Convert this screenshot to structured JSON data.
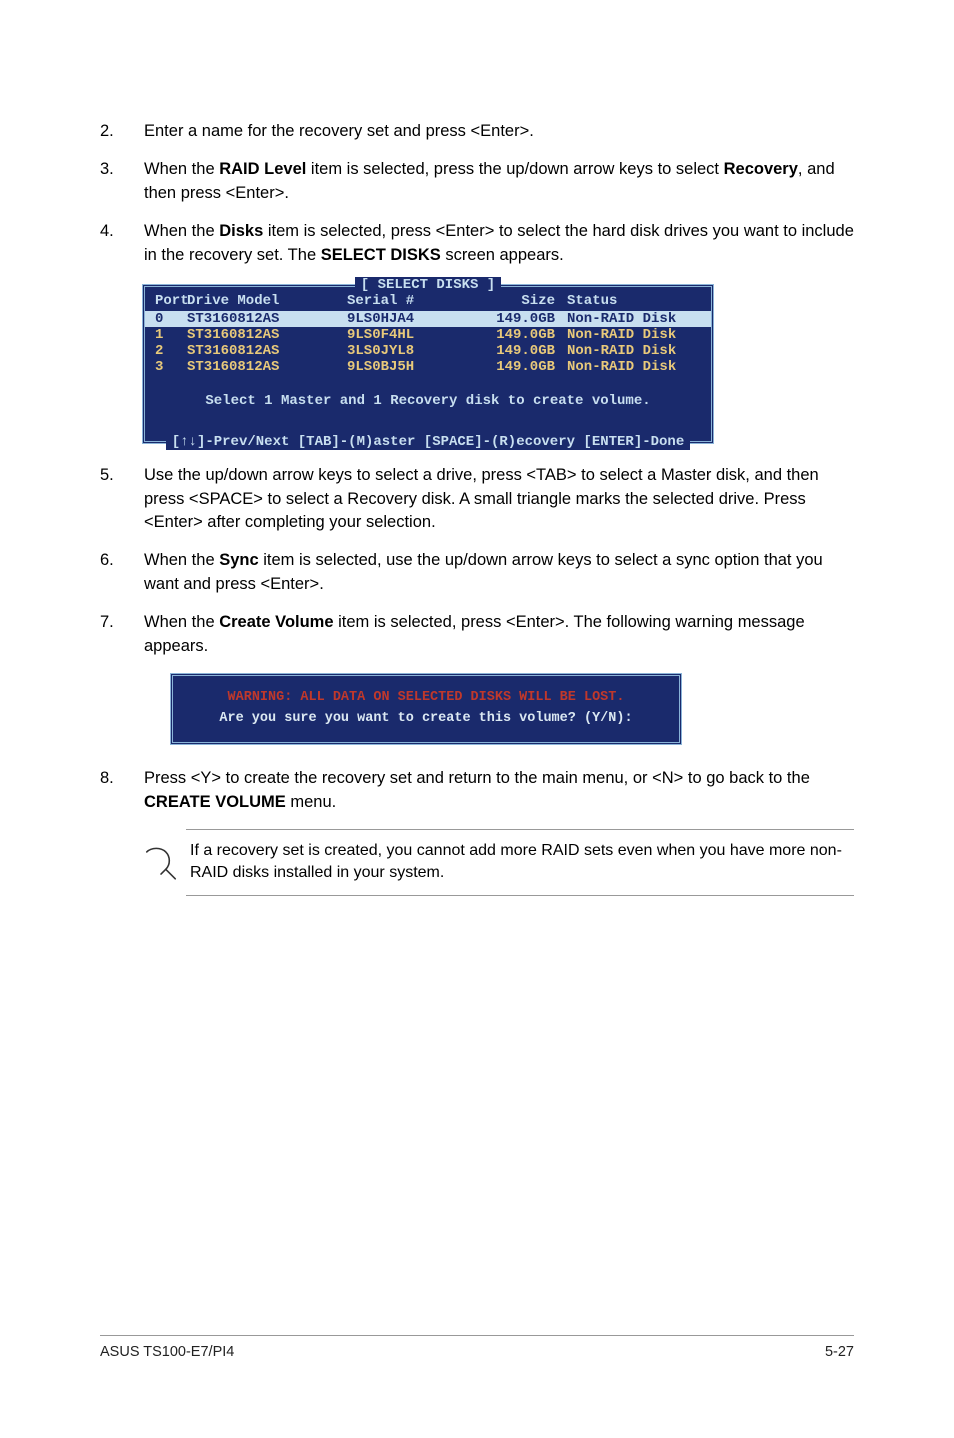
{
  "steps": {
    "s2": {
      "num": "2.",
      "text_a": "Enter a name for the recovery set and press <Enter>."
    },
    "s3": {
      "num": "3.",
      "text_a": "When the ",
      "b1": "RAID Level",
      "text_b": " item is selected, press the up/down arrow keys to select ",
      "b2": "Recovery",
      "text_c": ", and then press <Enter>."
    },
    "s4": {
      "num": "4.",
      "text_a": "When the ",
      "b1": "Disks",
      "text_b": " item is selected, press <Enter> to select the hard disk drives you want to include in the recovery set. The ",
      "b2": "SELECT DISKS",
      "text_c": " screen appears."
    },
    "s5": {
      "num": "5.",
      "text_a": "Use the up/down arrow keys to select a drive, press <TAB> to select a Master disk, and then press <SPACE> to select a Recovery disk. A small triangle marks the selected drive. Press <Enter> after completing your selection."
    },
    "s6": {
      "num": "6.",
      "text_a": "When the ",
      "b1": "Sync",
      "text_b": " item is selected, use the up/down arrow keys to select a sync option that you want and press <Enter>."
    },
    "s7": {
      "num": "7.",
      "text_a": "When the ",
      "b1": "Create Volume",
      "text_b": " item is selected, press <Enter>. The following warning message appears."
    },
    "s8": {
      "num": "8.",
      "text_a": "Press <Y> to create the recovery set and return to the main menu, or <N> to go back to the ",
      "b1": "CREATE VOLUME",
      "text_b": " menu."
    }
  },
  "bios": {
    "title": "[ SELECT DISKS ]",
    "headers": {
      "port": "Port",
      "model": "Drive Model",
      "serial": "Serial #",
      "size": "Size",
      "status": "Status"
    },
    "rows": [
      {
        "port": "0",
        "model": "ST3160812AS",
        "serial": "9LS0HJA4",
        "size": "149.0GB",
        "status": "Non-RAID Disk",
        "selected": true
      },
      {
        "port": "1",
        "model": "ST3160812AS",
        "serial": "9LS0F4HL",
        "size": "149.0GB",
        "status": "Non-RAID Disk",
        "selected": false
      },
      {
        "port": "2",
        "model": "ST3160812AS",
        "serial": "3LS0JYL8",
        "size": "149.0GB",
        "status": "Non-RAID Disk",
        "selected": false
      },
      {
        "port": "3",
        "model": "ST3160812AS",
        "serial": "9LS0BJ5H",
        "size": "149.0GB",
        "status": "Non-RAID Disk",
        "selected": false
      }
    ],
    "hint": "Select 1 Master and 1 Recovery disk to create volume.",
    "footer": "[↑↓]-Prev/Next [TAB]-(M)aster [SPACE]-(R)ecovery [ENTER]-Done"
  },
  "warning": {
    "line1": "WARNING: ALL DATA ON SELECTED DISKS WILL BE LOST.",
    "line2": "Are you sure you want to create this volume? (Y/N):"
  },
  "note": "If a recovery set is created, you cannot add more RAID sets even when you have more non-RAID disks installed in your system.",
  "footer": {
    "left": "ASUS TS100-E7/PI4",
    "right": "5-27"
  }
}
